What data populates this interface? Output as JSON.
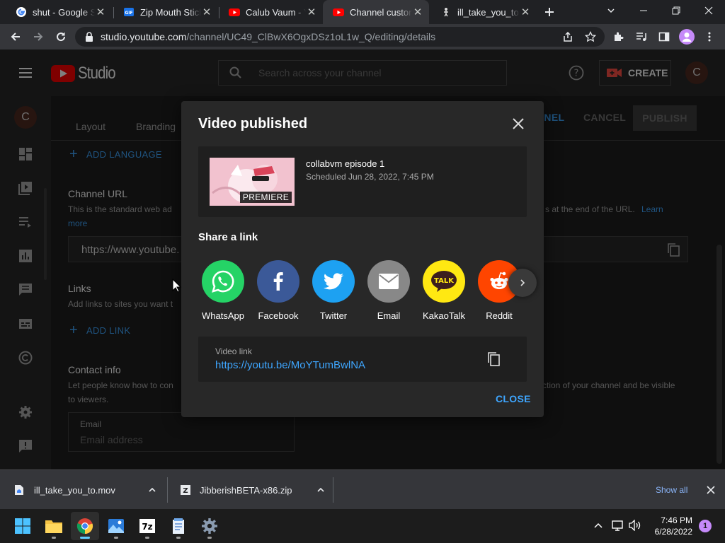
{
  "browser": {
    "tabs": [
      {
        "title": "shut - Google Search",
        "favicon": "google-icon",
        "active": false
      },
      {
        "title": "Zip Mouth Sticker",
        "favicon": "gif-icon",
        "active": false
      },
      {
        "title": "Calub Vaum - YouTube",
        "favicon": "youtube-icon",
        "active": false
      },
      {
        "title": "Channel customization",
        "favicon": "youtube-icon",
        "active": true
      },
      {
        "title": "ill_take_you_to.mov",
        "favicon": "figure-icon",
        "active": false
      }
    ],
    "url_host": "studio.youtube.com",
    "url_path": "/channel/UC49_ClBwX6OgxDSz1oL1w_Q/editing/details"
  },
  "studio": {
    "logo_text": "Studio",
    "search_placeholder": "Search across your channel",
    "create_label": "CREATE",
    "avatar_letter": "C",
    "tabs": [
      "Layout",
      "Branding"
    ],
    "actions": {
      "view_channel": "NNEL",
      "cancel": "CANCEL",
      "publish": "PUBLISH"
    },
    "add_language": "ADD LANGUAGE",
    "channel_url": {
      "label": "Channel URL",
      "desc_left": "This is the standard web ad",
      "desc_right": "s at the end of the URL.",
      "learn": "Learn",
      "more": "more",
      "value": "https://www.youtube."
    },
    "links": {
      "label": "Links",
      "desc": "Add links to sites you want t",
      "add": "ADD LINK"
    },
    "contact": {
      "label": "Contact info",
      "desc_left": "Let people know how to con",
      "desc_right": "ction of your channel and be visible",
      "desc_line2": "to viewers.",
      "email_label": "Email",
      "email_placeholder": "Email address"
    }
  },
  "dialog": {
    "title": "Video published",
    "video_title": "collabvm episode 1",
    "scheduled": "Scheduled Jun 28, 2022, 7:45 PM",
    "badge": "PREMIERE",
    "share_heading": "Share a link",
    "share_targets": [
      {
        "label": "WhatsApp",
        "icon": "whatsapp-icon",
        "color": "#25d366"
      },
      {
        "label": "Facebook",
        "icon": "facebook-icon",
        "color": "#3b5998"
      },
      {
        "label": "Twitter",
        "icon": "twitter-icon",
        "color": "#1da1f2"
      },
      {
        "label": "Email",
        "icon": "email-icon",
        "color": "#888888"
      },
      {
        "label": "KakaoTalk",
        "icon": "kakaotalk-icon",
        "color": "#ffe812"
      },
      {
        "label": "Reddit",
        "icon": "reddit-icon",
        "color": "#ff4500"
      }
    ],
    "video_link_label": "Video link",
    "video_link": "https://youtu.be/MoYTumBwlNA",
    "close_label": "CLOSE"
  },
  "downloads": {
    "items": [
      {
        "name": "ill_take_you_to.mov",
        "icon": "file-icon"
      },
      {
        "name": "JibberishBETA-x86.zip",
        "icon": "zip-icon"
      }
    ],
    "show_all": "Show all"
  },
  "taskbar": {
    "apps": [
      "start-icon",
      "file-explorer-icon",
      "chrome-icon",
      "photos-icon",
      "7zip-icon",
      "notepad-icon",
      "settings-icon"
    ],
    "time": "7:46 PM",
    "date": "6/28/2022",
    "notification_count": "1"
  }
}
